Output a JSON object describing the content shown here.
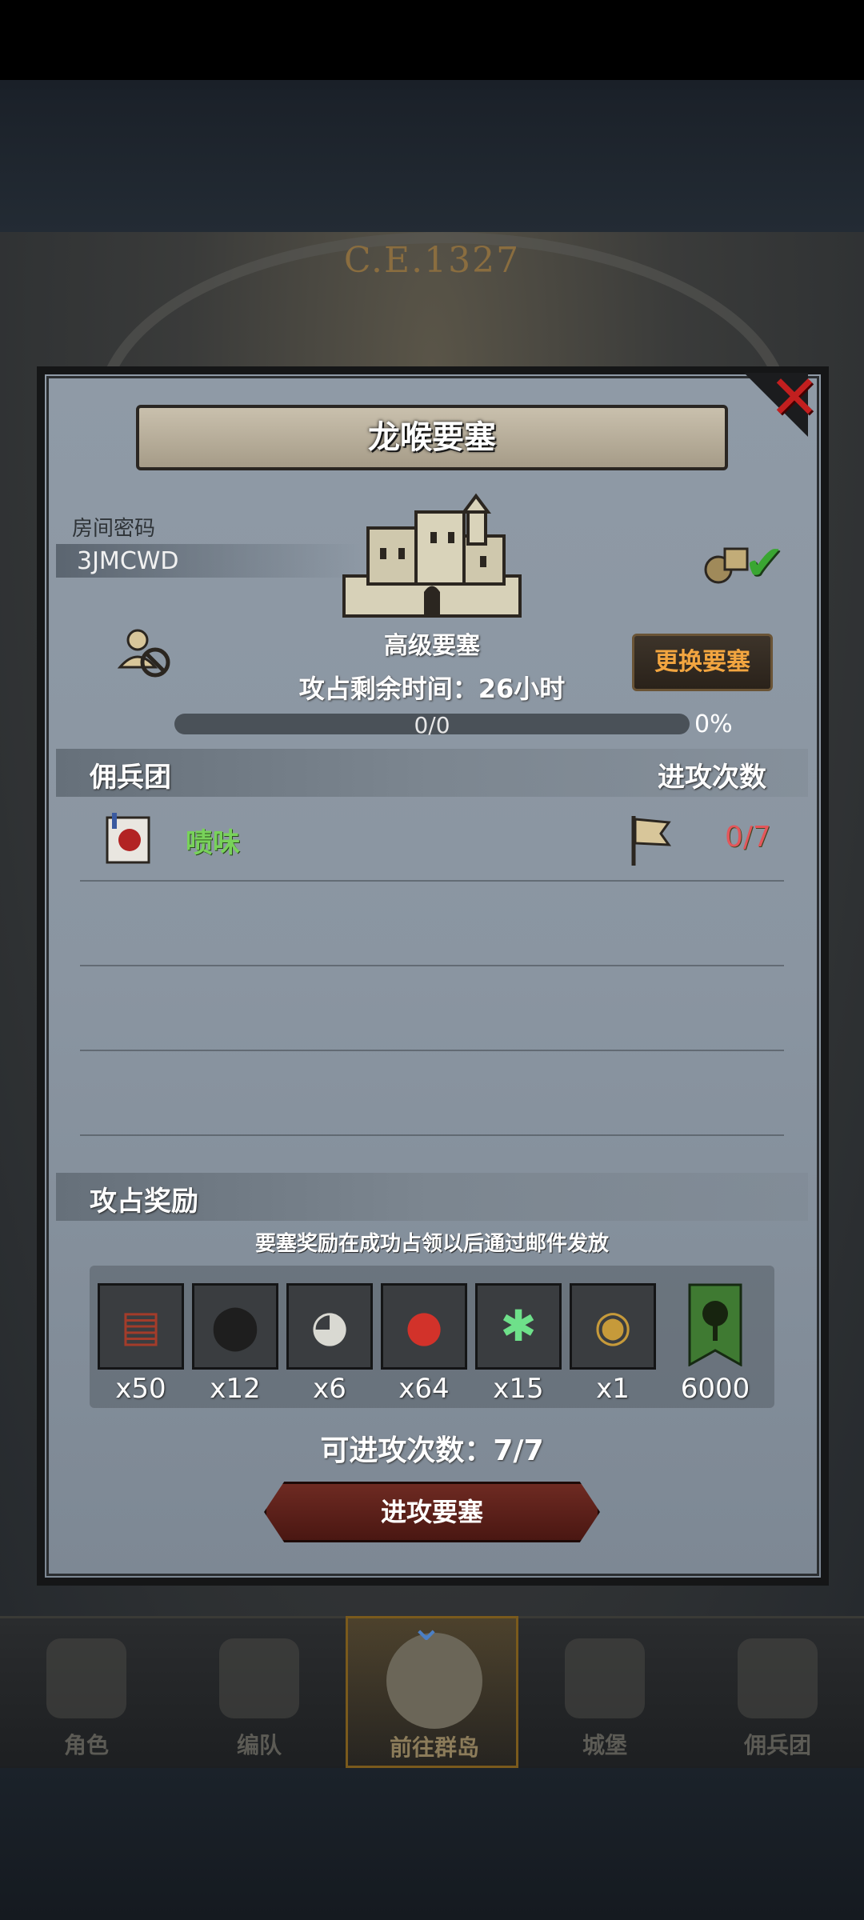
{
  "background": {
    "era_label": "C.E.1327",
    "nav": [
      {
        "label": "角色",
        "icon": "knight-helmet-icon"
      },
      {
        "label": "编队",
        "icon": "armored-soldier-icon"
      },
      {
        "label": "前往群岛",
        "icon": "globe-map-icon"
      },
      {
        "label": "城堡",
        "icon": "castle-icon"
      },
      {
        "label": "佣兵团",
        "icon": "mercenary-tower-icon"
      }
    ]
  },
  "dialog": {
    "title": "龙喉要塞",
    "room_label": "房间密码",
    "room_code": "3JMCWD",
    "fortress_grade": "高级要塞",
    "swap_button": "更换要塞",
    "time_remaining": "攻占剩余时间：26小时",
    "progress_text": "0/0",
    "progress_value": 0,
    "progress_percent": "0%",
    "mercenary_header": "佣兵团",
    "attack_count_header": "进攻次数",
    "mercenaries": [
      {
        "name": "啧味",
        "attacks": "0/7",
        "banner_icon": "wolf-banner-icon"
      }
    ],
    "reward_header": "攻占奖励",
    "reward_note": "要塞奖励在成功占领以后通过邮件发放",
    "rewards": [
      {
        "icon": "wood-planks-icon",
        "qty": "x50"
      },
      {
        "icon": "ore-rock-icon",
        "qty": "x12"
      },
      {
        "icon": "silver-bowl-icon",
        "qty": "x6"
      },
      {
        "icon": "berries-icon",
        "qty": "x64"
      },
      {
        "icon": "spirit-tree-icon",
        "qty": "x15"
      },
      {
        "icon": "golden-helmet-icon",
        "qty": "x1"
      },
      {
        "icon": "tree-banner-icon",
        "qty": "6000"
      }
    ],
    "attempts_left": "可进攻次数：7/7",
    "attack_button": "进攻要塞"
  },
  "colors": {
    "close_red": "#c21f1f",
    "merc_name_green": "#78d25a",
    "count_red": "#e3565a",
    "swap_orange": "#f2a540"
  }
}
